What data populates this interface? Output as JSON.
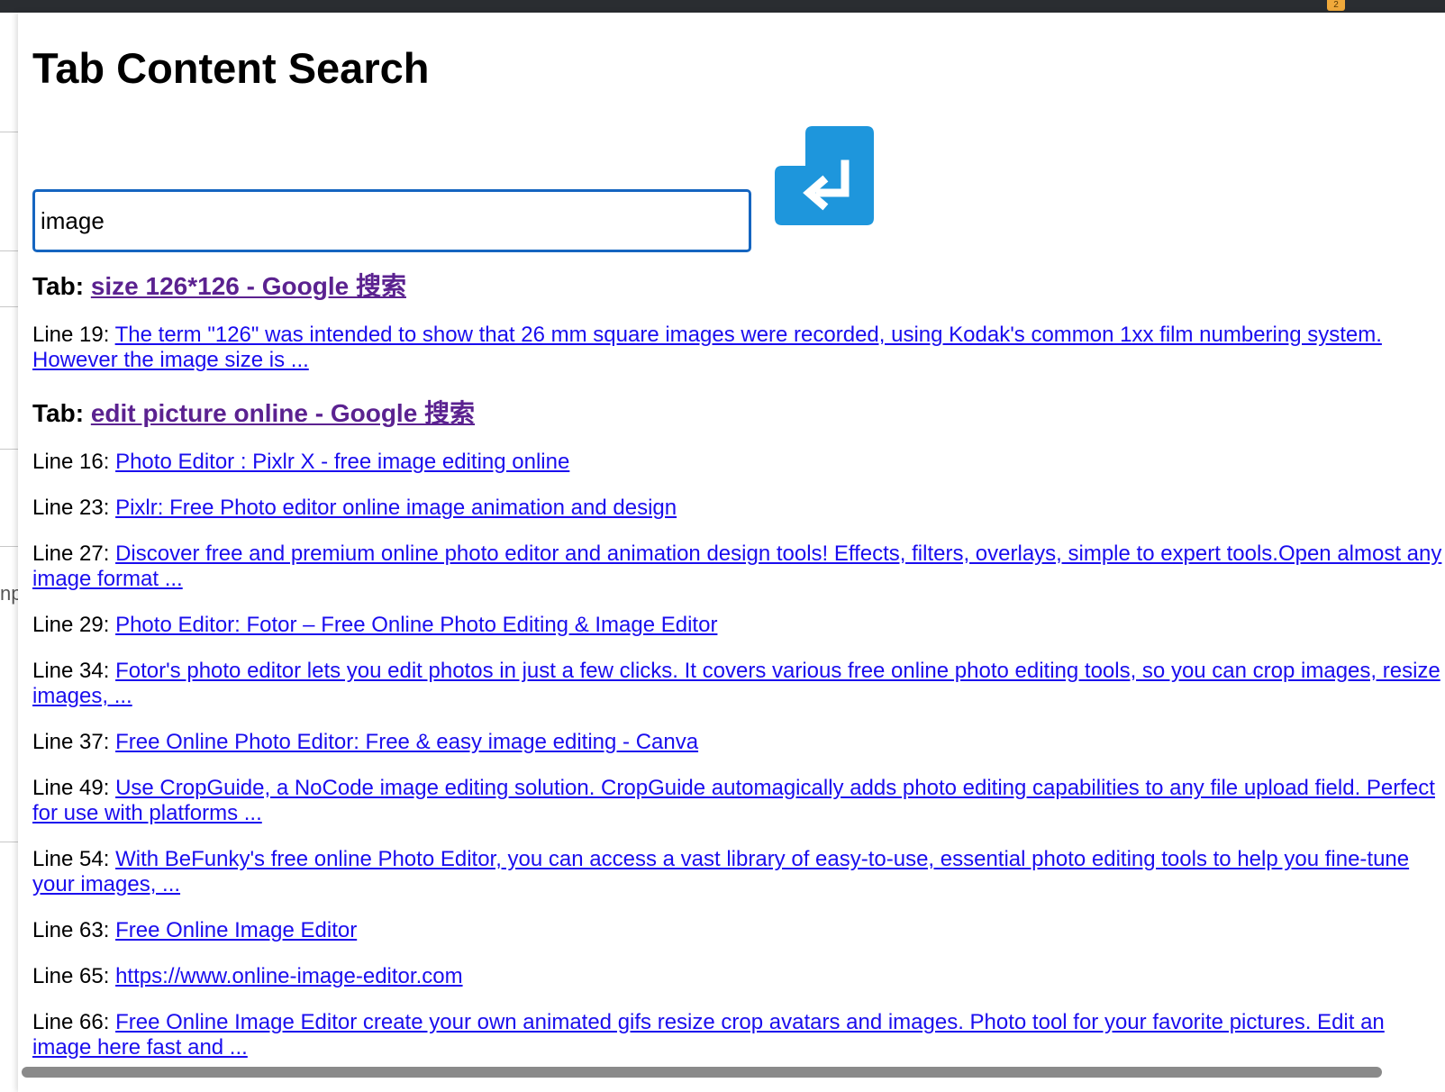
{
  "browser": {
    "badge": "2"
  },
  "background": {
    "fragment": "np"
  },
  "popup": {
    "title": "Tab Content Search",
    "search": {
      "value": "image"
    },
    "enter_button_icon": "enter-return-icon",
    "accent_color": "#1e96dc",
    "results": [
      {
        "tab_prefix": "Tab: ",
        "tab_title": "size 126*126 - Google 搜索",
        "lines": [
          {
            "label": "Line 19: ",
            "text": "The term \"126\" was intended to show that 26 mm square images were recorded, using Kodak's common 1xx film numbering system. However the image size is ..."
          }
        ]
      },
      {
        "tab_prefix": "Tab: ",
        "tab_title": "edit picture online - Google 搜索",
        "lines": [
          {
            "label": "Line 16: ",
            "text": "Photo Editor : Pixlr X - free image editing online"
          },
          {
            "label": "Line 23: ",
            "text": "Pixlr: Free Photo editor online image animation and design"
          },
          {
            "label": "Line 27: ",
            "text": "Discover free and premium online photo editor and animation design tools! Effects, filters, overlays, simple to expert tools.Open almost any image format ..."
          },
          {
            "label": "Line 29: ",
            "text": "Photo Editor: Fotor – Free Online Photo Editing & Image Editor"
          },
          {
            "label": "Line 34: ",
            "text": "Fotor's photo editor lets you edit photos in just a few clicks. It covers various free online photo editing tools, so you can crop images, resize images, ..."
          },
          {
            "label": "Line 37: ",
            "text": "Free Online Photo Editor: Free & easy image editing - Canva"
          },
          {
            "label": "Line 49: ",
            "text": "Use CropGuide, a NoCode image editing solution. CropGuide automagically adds photo editing capabilities to any file upload field. Perfect for use with platforms ..."
          },
          {
            "label": "Line 54: ",
            "text": "With BeFunky's free online Photo Editor, you can access a vast library of easy-to-use, essential photo editing tools to help you fine-tune your images, ..."
          },
          {
            "label": "Line 63: ",
            "text": "Free Online Image Editor"
          },
          {
            "label": "Line 65: ",
            "text": "https://www.online-image-editor.com"
          },
          {
            "label": "Line 66: ",
            "text": "Free Online Image Editor create your own animated gifs resize crop avatars and images. Photo tool for your favorite pictures. Edit an image here fast and ..."
          }
        ]
      }
    ]
  }
}
